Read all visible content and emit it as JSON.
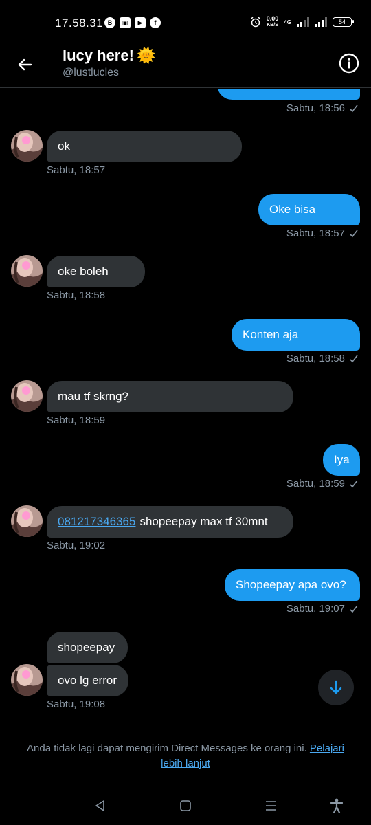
{
  "status_bar": {
    "time": "17.58.31",
    "icons": [
      "b-icon",
      "camera-icon",
      "youtube-icon",
      "flip-icon"
    ],
    "speed_top": "0.00",
    "speed_bottom": "KB/S",
    "network": "4G",
    "battery": "54"
  },
  "header": {
    "title": "lucy here!",
    "title_emoji": "🌞",
    "handle": "@lustlucles"
  },
  "messages": [
    {
      "dir": "out",
      "text": "",
      "time": "Sabtu, 18:56",
      "seen": true
    },
    {
      "dir": "in",
      "text": "ok",
      "time": "Sabtu, 18:57"
    },
    {
      "dir": "out",
      "text": "Oke bisa",
      "time": "Sabtu, 18:57",
      "seen": true
    },
    {
      "dir": "in",
      "text": "oke boleh",
      "time": "Sabtu, 18:58"
    },
    {
      "dir": "out",
      "text": "Konten aja",
      "time": "Sabtu, 18:58",
      "seen": true
    },
    {
      "dir": "in",
      "text": "mau tf skrng?",
      "time": "Sabtu, 18:59"
    },
    {
      "dir": "out",
      "text": "Iya",
      "time": "Sabtu, 18:59",
      "seen": true
    },
    {
      "dir": "in",
      "link": "081217346365",
      "text": "shopeepay max tf 30mnt",
      "time": "Sabtu, 19:02"
    },
    {
      "dir": "out",
      "text": "Shopeepay apa ovo?",
      "time": "Sabtu, 19:07",
      "seen": true
    },
    {
      "dir": "in",
      "text": "shopeepay",
      "time": ""
    },
    {
      "dir": "in",
      "text": "ovo lg error",
      "time": "Sabtu, 19:08"
    }
  ],
  "notice": {
    "text": "Anda tidak lagi dapat mengirim Direct Messages ke orang ini.",
    "link": "Pelajari lebih lanjut"
  },
  "colors": {
    "background": "#000000",
    "incoming_bubble": "#2f3336",
    "outgoing_bubble": "#1d9bf0",
    "link": "#4aa8f0",
    "muted": "#8b98a5"
  }
}
